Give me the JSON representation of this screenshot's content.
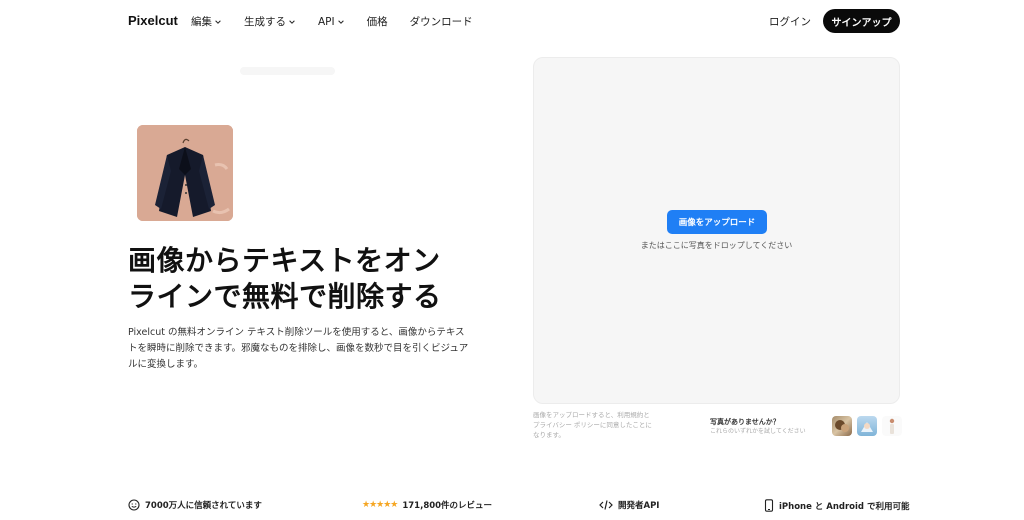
{
  "header": {
    "logo": "Pixelcut",
    "nav": [
      {
        "label": "編集",
        "has_chevron": true
      },
      {
        "label": "生成する",
        "has_chevron": true
      },
      {
        "label": "API",
        "has_chevron": true
      },
      {
        "label": "価格",
        "has_chevron": false
      },
      {
        "label": "ダウンロード",
        "has_chevron": false
      }
    ],
    "login_label": "ログイン",
    "signup_label": "サインアップ"
  },
  "hero": {
    "image_icon": "jacket-photo",
    "title": "画像からテキストをオンラインで無料で削除する",
    "description": "Pixelcut の無料オンライン テキスト削除ツールを使用すると、画像からテキストを瞬時に削除できます。邪魔なものを排除し、画像を数秒で目を引くビジュアルに変換します。"
  },
  "upload": {
    "button_label": "画像をアップロード",
    "drop_text": "またはここに写真をドロップしてください",
    "terms_text": "画像をアップロードすると、利用規約とプライバシー ポリシーに同意したことになります。",
    "no_photo_title": "写真がありませんか？",
    "no_photo_sub": "これらのいずれかを試してください",
    "samples": [
      "sample-photo-1",
      "sample-photo-2",
      "sample-photo-3"
    ]
  },
  "features": [
    {
      "icon": "smile-icon",
      "label": "7000万人に信頼されています"
    },
    {
      "icon": "star-rating-icon",
      "label": "171,800件のレビュー"
    },
    {
      "icon": "code-icon",
      "label": "開発者API"
    },
    {
      "icon": "phone-icon",
      "label": "iPhone と Android で利用可能"
    }
  ],
  "colors": {
    "accent": "#1f7ff5",
    "signup_bg": "#0a0a0a",
    "card_bg": "#f6f6f6",
    "star": "#f5a623"
  }
}
